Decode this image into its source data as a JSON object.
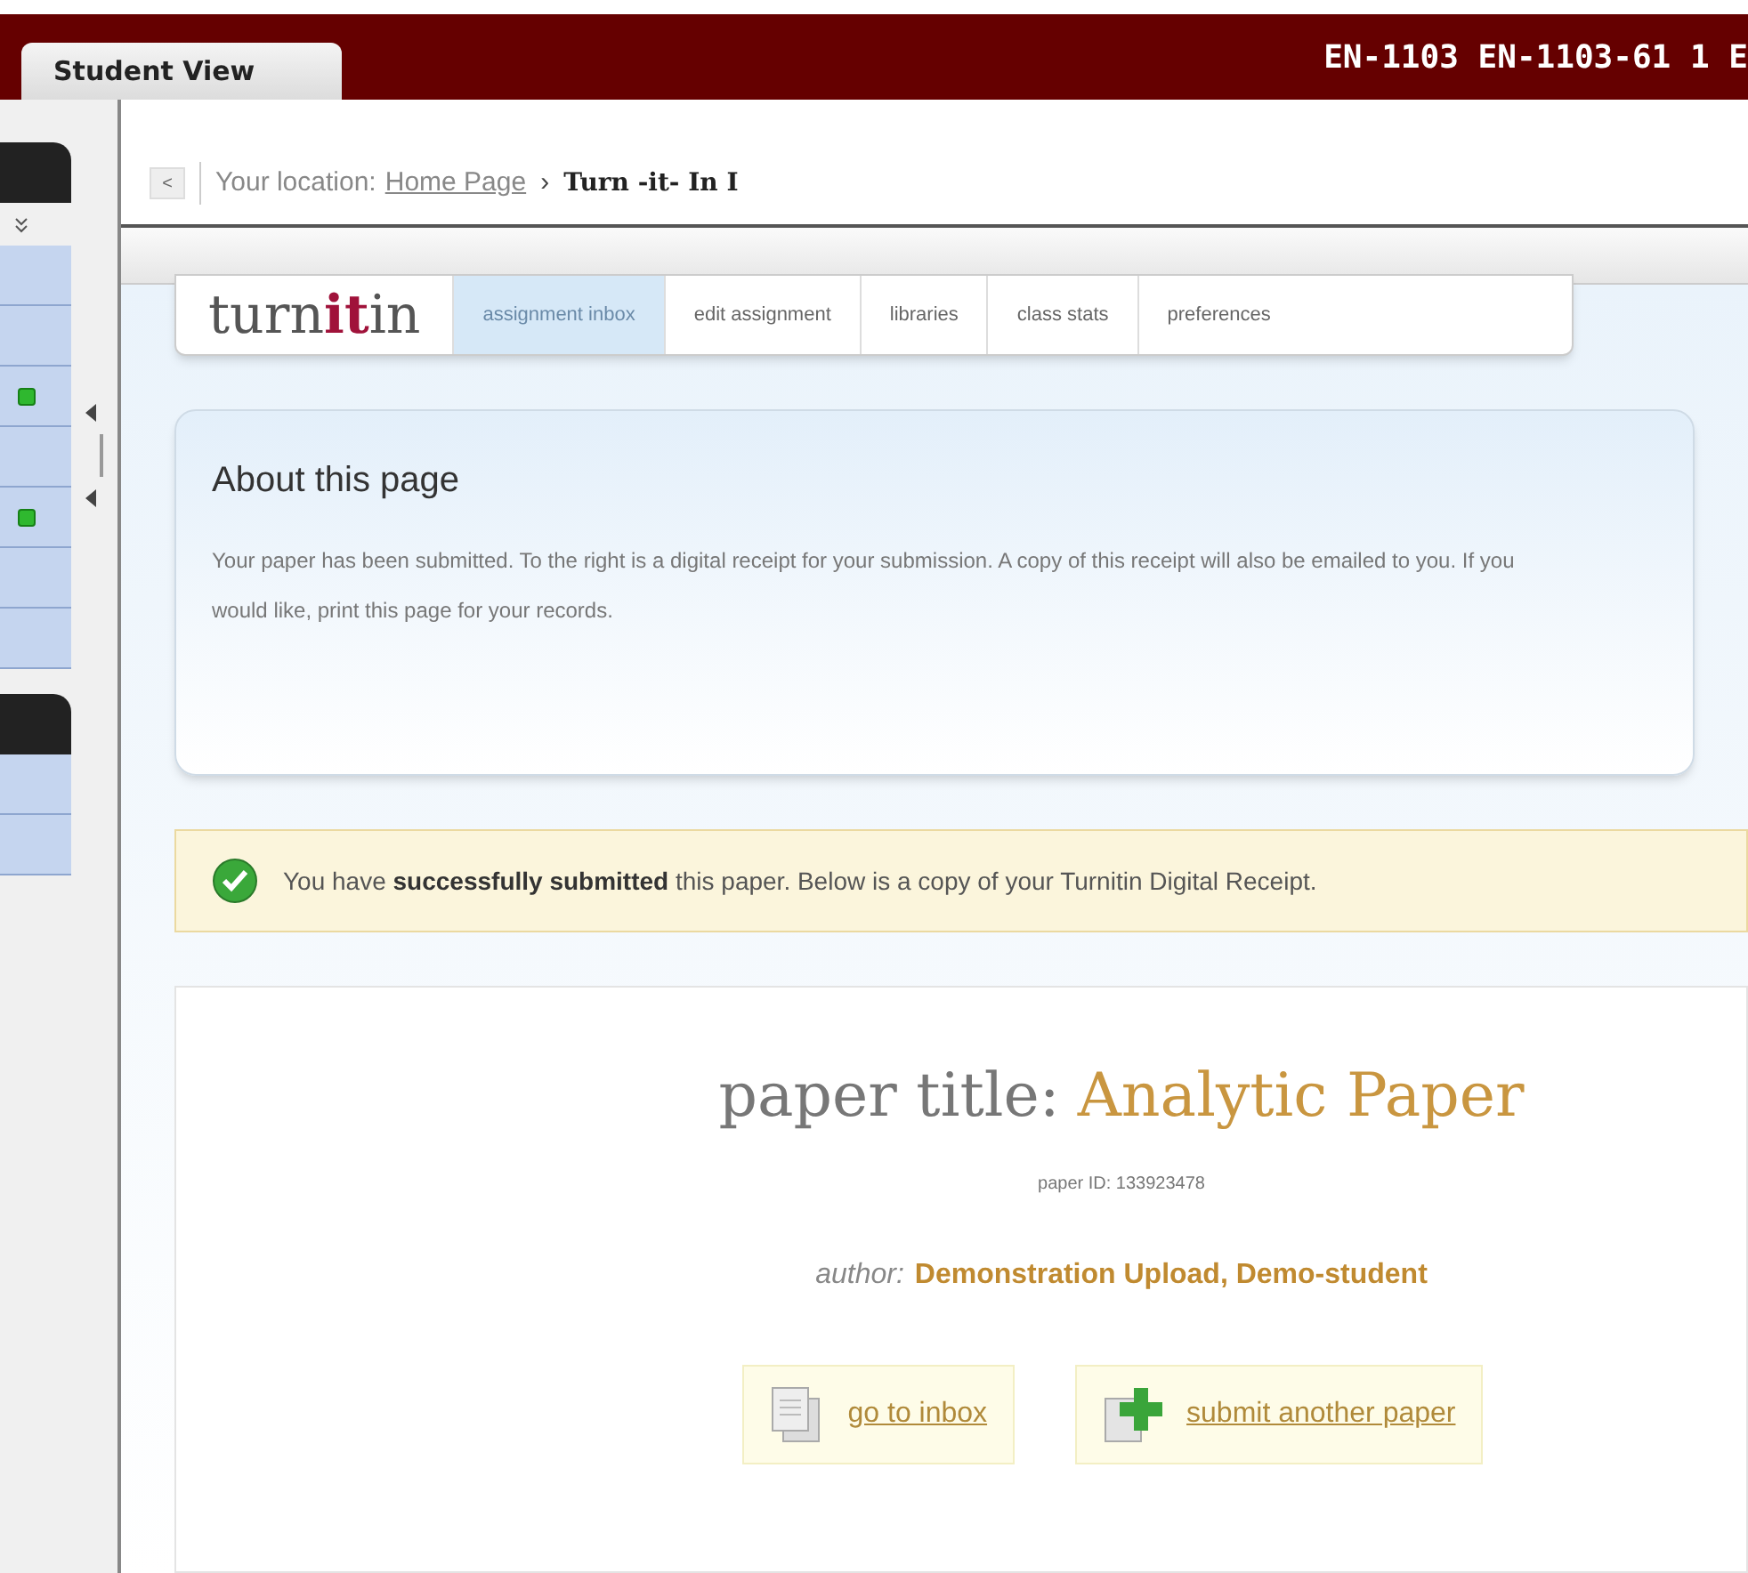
{
  "header": {
    "tab": "Student View",
    "course": "EN-1103 EN-1103-61 1 E"
  },
  "sidebar": {
    "rows": [
      {
        "marked": false
      },
      {
        "marked": false
      },
      {
        "marked": true
      },
      {
        "marked": false
      },
      {
        "marked": true
      },
      {
        "marked": false
      },
      {
        "marked": false
      }
    ],
    "lower_rows": [
      {
        "marked": false
      },
      {
        "marked": false
      }
    ]
  },
  "breadcrumb": {
    "back": "<",
    "label": "Your location:",
    "home": "Home Page",
    "separator": "›",
    "current": "Turn -it- In I"
  },
  "logo": "turn**it**in",
  "tabs": [
    {
      "label": "assignment inbox",
      "selected": true
    },
    {
      "label": "edit assignment",
      "selected": false
    },
    {
      "label": "libraries",
      "selected": false
    },
    {
      "label": "class stats",
      "selected": false
    },
    {
      "label": "preferences",
      "selected": false
    }
  ],
  "about": {
    "title": "About this page",
    "text": "Your paper has been submitted. To the right is a digital receipt for your submission. A copy of this receipt will also be emailed to you. If you would like, print this page for your records."
  },
  "notice": "You have **successfully submitted** this paper. Below is a copy of your Turnitin Digital Receipt.",
  "receipt": {
    "title_label": "paper title:",
    "title": "Analytic Paper",
    "paper_id": "paper ID: 133923478",
    "author_label": "author:",
    "author": "Demonstration Upload, Demo-student",
    "actions": [
      {
        "kind": "inbox",
        "label": "go to inbox"
      },
      {
        "kind": "submit",
        "label": "submit another paper"
      }
    ]
  }
}
